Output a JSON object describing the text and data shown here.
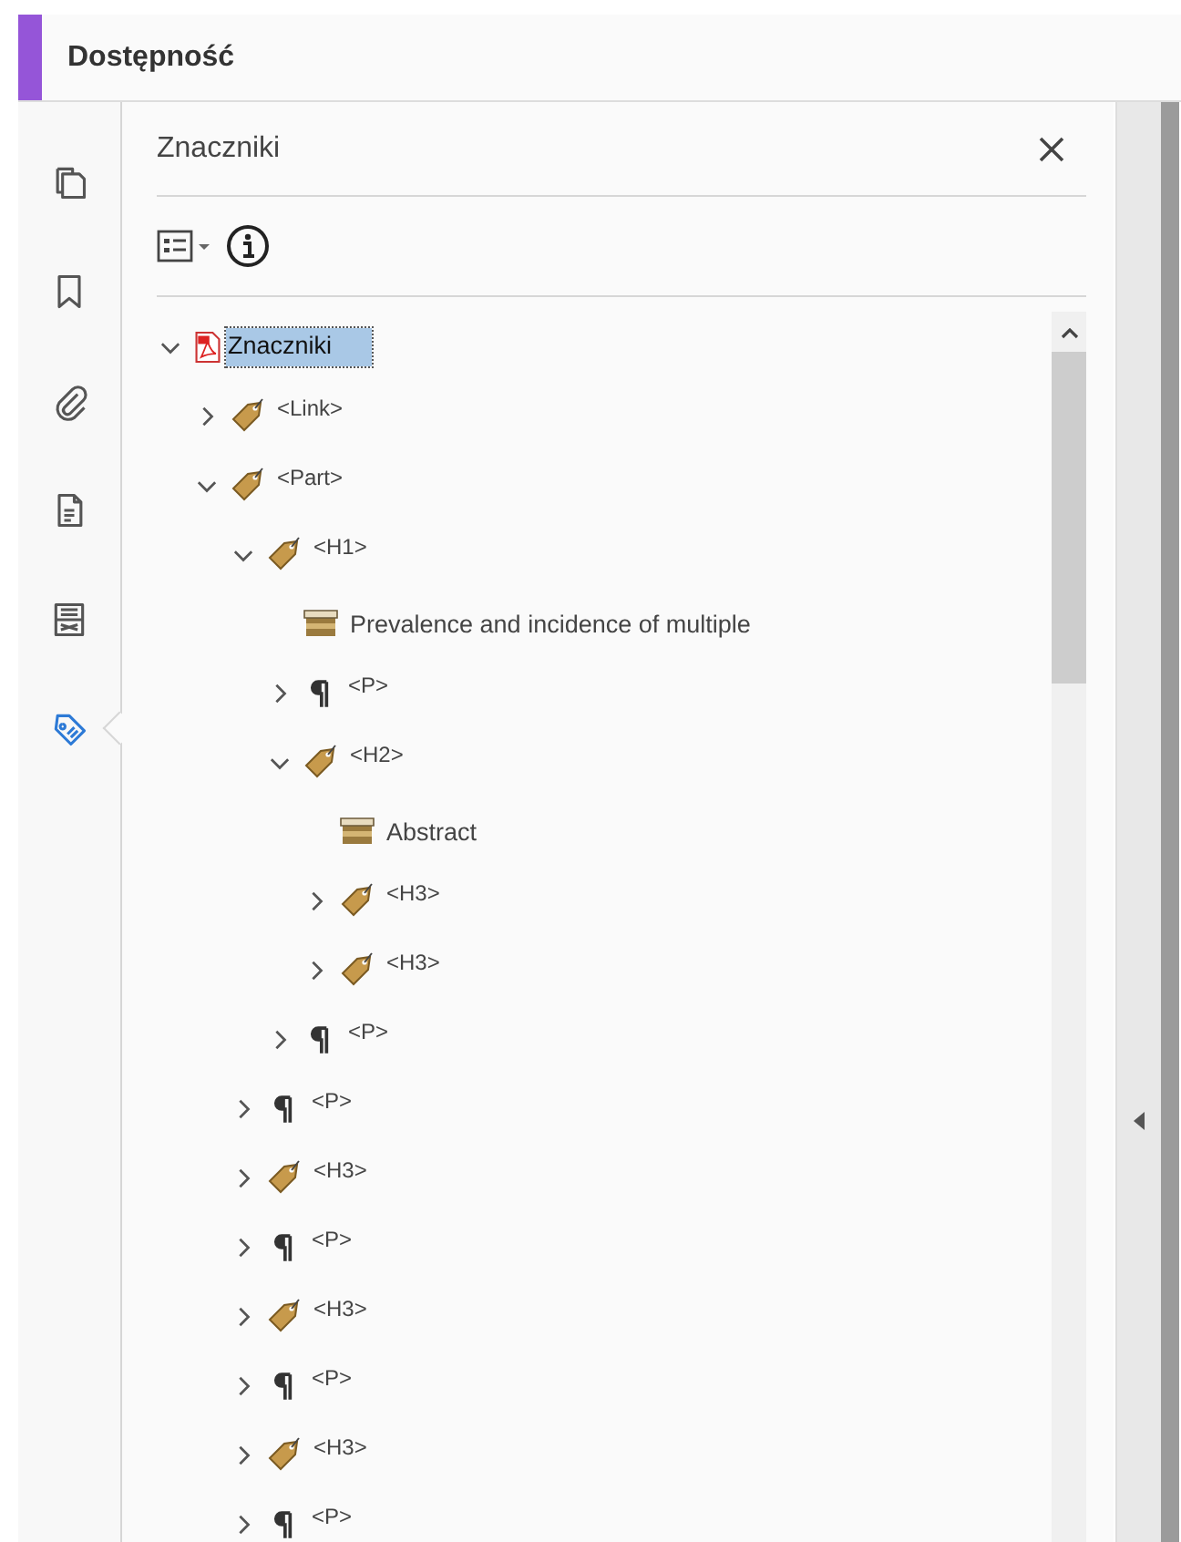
{
  "header": {
    "title": "Dostępność"
  },
  "rail": [
    {
      "kind": "pages",
      "selected": false
    },
    {
      "kind": "bookmark",
      "selected": false
    },
    {
      "kind": "attachment",
      "selected": false
    },
    {
      "kind": "document",
      "selected": false
    },
    {
      "kind": "content",
      "selected": false
    },
    {
      "kind": "tags",
      "selected": true
    }
  ],
  "panel": {
    "title": "Znaczniki"
  },
  "tree": [
    {
      "label": "Znaczniki",
      "kind": "pdf",
      "expanded": true,
      "selected": true,
      "children": [
        {
          "label": "<Link>",
          "kind": "tag",
          "expanded": false,
          "selected": false
        },
        {
          "label": "<Part>",
          "kind": "tag",
          "expanded": true,
          "selected": false,
          "children": [
            {
              "label": "<H1>",
              "kind": "tag",
              "expanded": true,
              "selected": false,
              "children": [
                {
                  "label": "Prevalence and incidence of multiple",
                  "kind": "box",
                  "selected": false
                },
                {
                  "label": "<P>",
                  "kind": "para",
                  "expanded": false,
                  "selected": false
                },
                {
                  "label": "<H2>",
                  "kind": "tag",
                  "expanded": true,
                  "selected": false,
                  "children": [
                    {
                      "label": "Abstract",
                      "kind": "box",
                      "selected": false
                    },
                    {
                      "label": "<H3>",
                      "kind": "tag",
                      "expanded": false,
                      "selected": false
                    },
                    {
                      "label": "<H3>",
                      "kind": "tag",
                      "expanded": false,
                      "selected": false
                    }
                  ]
                },
                {
                  "label": "<P>",
                  "kind": "para",
                  "expanded": false,
                  "selected": false
                }
              ]
            },
            {
              "label": "<P>",
              "kind": "para",
              "expanded": false,
              "selected": false
            },
            {
              "label": "<H3>",
              "kind": "tag",
              "expanded": false,
              "selected": false
            },
            {
              "label": "<P>",
              "kind": "para",
              "expanded": false,
              "selected": false
            },
            {
              "label": "<H3>",
              "kind": "tag",
              "expanded": false,
              "selected": false
            },
            {
              "label": "<P>",
              "kind": "para",
              "expanded": false,
              "selected": false
            },
            {
              "label": "<H3>",
              "kind": "tag",
              "expanded": false,
              "selected": false
            },
            {
              "label": "<P>",
              "kind": "para",
              "expanded": false,
              "selected": false
            }
          ]
        }
      ]
    }
  ]
}
